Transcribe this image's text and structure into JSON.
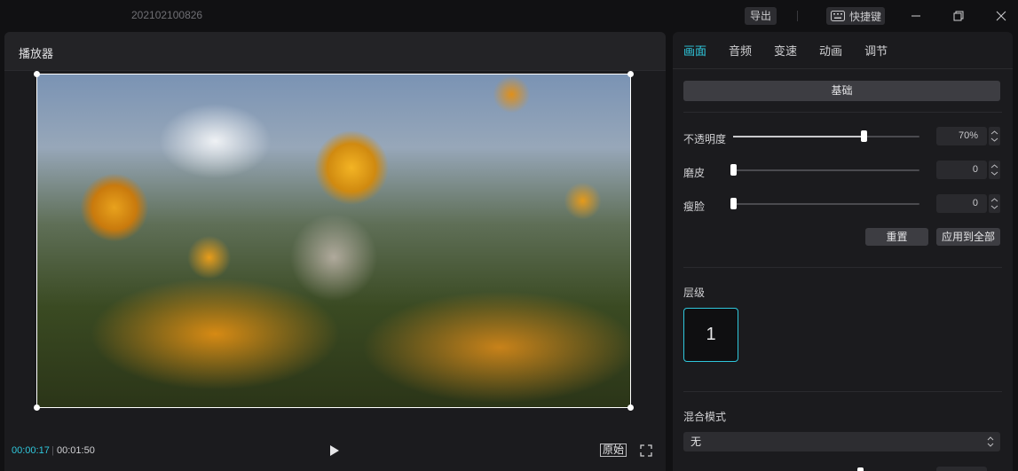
{
  "titlebar": {
    "project_name": "202102100826",
    "export_label": "导出",
    "shortcut_label": "快捷键"
  },
  "player": {
    "title": "播放器",
    "current_time": "00:00:17",
    "separator": "|",
    "total_time": "00:01:50",
    "original_label": "原始"
  },
  "inspector": {
    "tabs": [
      {
        "label": "画面",
        "active": true
      },
      {
        "label": "音频",
        "active": false
      },
      {
        "label": "变速",
        "active": false
      },
      {
        "label": "动画",
        "active": false
      },
      {
        "label": "调节",
        "active": false
      }
    ],
    "section_basic": "基础",
    "opacity": {
      "label": "不透明度",
      "value": "70%",
      "level": 0.7
    },
    "smooth": {
      "label": "磨皮",
      "value": "0",
      "level": 0
    },
    "slim_face": {
      "label": "瘦脸",
      "value": "0",
      "level": 0
    },
    "reset_label": "重置",
    "apply_all_label": "应用到全部",
    "layer": {
      "label": "层级",
      "value": "1"
    },
    "blend_mode": {
      "label": "混合模式",
      "value": "无"
    }
  },
  "colors": {
    "accent": "#2fc7dc",
    "background": "#111113",
    "panel": "#1b1b1e"
  }
}
